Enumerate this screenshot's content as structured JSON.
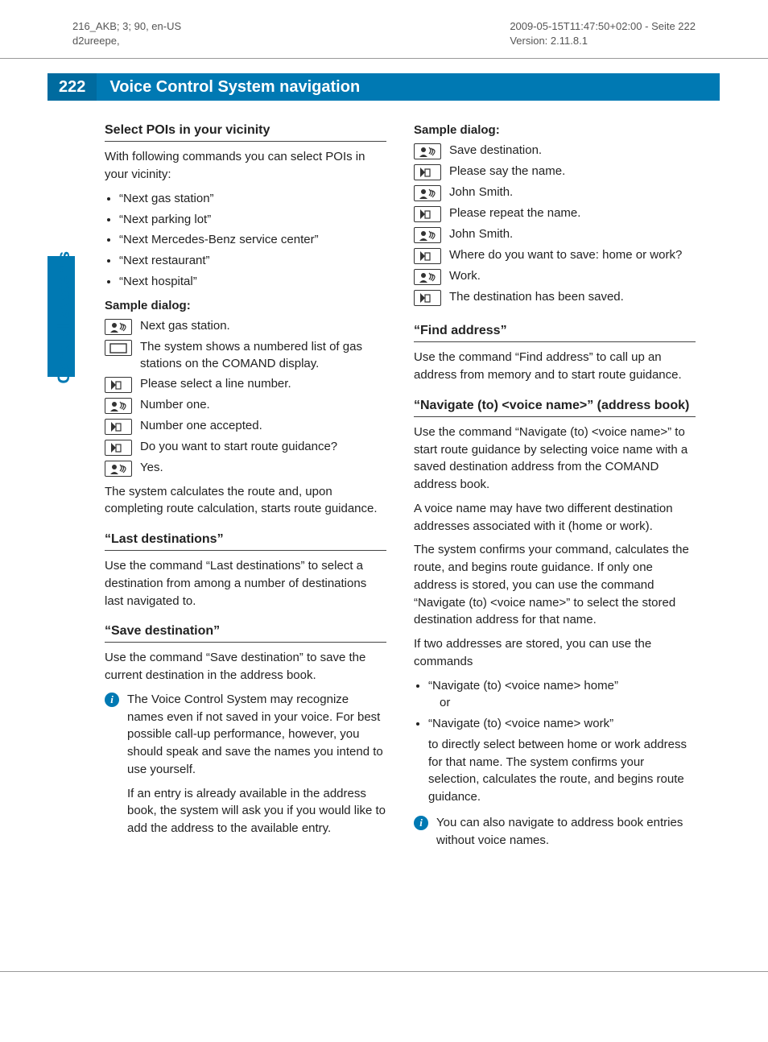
{
  "meta": {
    "top_left_l1": "216_AKB; 3; 90, en-US",
    "top_left_l2": "d2ureepe,",
    "top_right_l1": "2009-05-15T11:47:50+02:00 - Seite 222",
    "top_right_l2": "Version: 2.11.8.1"
  },
  "page_number": "222",
  "page_title": "Voice Control System navigation",
  "side_label": "Control systems",
  "left": {
    "h_poi": "Select POIs in your vicinity",
    "p_poi": "With following commands you can select POIs in your vicinity:",
    "poi_cmds": [
      "“Next gas station”",
      "“Next parking lot”",
      "“Next Mercedes-Benz service center”",
      "“Next restaurant”",
      "“Next hospital”"
    ],
    "sd_label": "Sample dialog:",
    "dialog": [
      {
        "icon": "user",
        "text": "Next gas station."
      },
      {
        "icon": "display",
        "text": "The system shows a numbered list of gas stations on the COMAND display."
      },
      {
        "icon": "system",
        "text": "Please select a line number."
      },
      {
        "icon": "user",
        "text": "Number one."
      },
      {
        "icon": "system",
        "text": "Number one accepted."
      },
      {
        "icon": "system",
        "text": "Do you want to start route guidance?"
      },
      {
        "icon": "user",
        "text": "Yes."
      }
    ],
    "p_after": "The system calculates the route and, upon completing route calculation, starts route guidance.",
    "h_last": "“Last destinations”",
    "p_last": "Use the command “Last destinations” to select a destination from among a number of destinations last navigated to.",
    "h_save": "“Save destination”",
    "p_save": "Use the command “Save destination” to save the current destination in the address book.",
    "info1": "The Voice Control System may recognize names even if not saved in your voice. For best possible call-up performance, however, you should speak and save the names you intend to use yourself.",
    "info1b": "If an entry is already available in the address book, the system will ask you if you would like to add the address to the available entry."
  },
  "right": {
    "sd_label": "Sample dialog:",
    "dialog": [
      {
        "icon": "user",
        "text": "Save destination."
      },
      {
        "icon": "system",
        "text": "Please say the name."
      },
      {
        "icon": "user",
        "text": "John Smith."
      },
      {
        "icon": "system",
        "text": "Please repeat the name."
      },
      {
        "icon": "user",
        "text": "John Smith."
      },
      {
        "icon": "system",
        "text": "Where do you want to save: home or work?"
      },
      {
        "icon": "user",
        "text": "Work."
      },
      {
        "icon": "system",
        "text": "The destination has been saved."
      }
    ],
    "h_find": "“Find address”",
    "p_find": "Use the command “Find address” to call up an address from memory and to start route guidance.",
    "h_nav": "“Navigate (to) <voice name>” (address book)",
    "p_nav1": "Use the command “Navigate (to) <voice name>” to start route guidance by selecting voice name with a saved destination address from the COMAND address book.",
    "p_nav2": "A voice name may have two different destination addresses associated with it (home or work).",
    "p_nav3": "The system confirms your command, calculates the route, and begins route guidance. If only one address is stored, you can use the command “Navigate (to) <voice name>” to select the stored destination address for that name.",
    "p_nav4": "If two addresses are stored, you can use the commands",
    "nav_cmds_1": "“Navigate (to) <voice name> home”",
    "nav_or": "or",
    "nav_cmds_2": "“Navigate (to) <voice name> work”",
    "nav_cmds_2b": "to directly select between home or work address for that name. The system confirms your selection, calculates the route, and begins route guidance.",
    "info2": "You can also navigate to address book entries without voice names."
  },
  "info_glyph": "i"
}
